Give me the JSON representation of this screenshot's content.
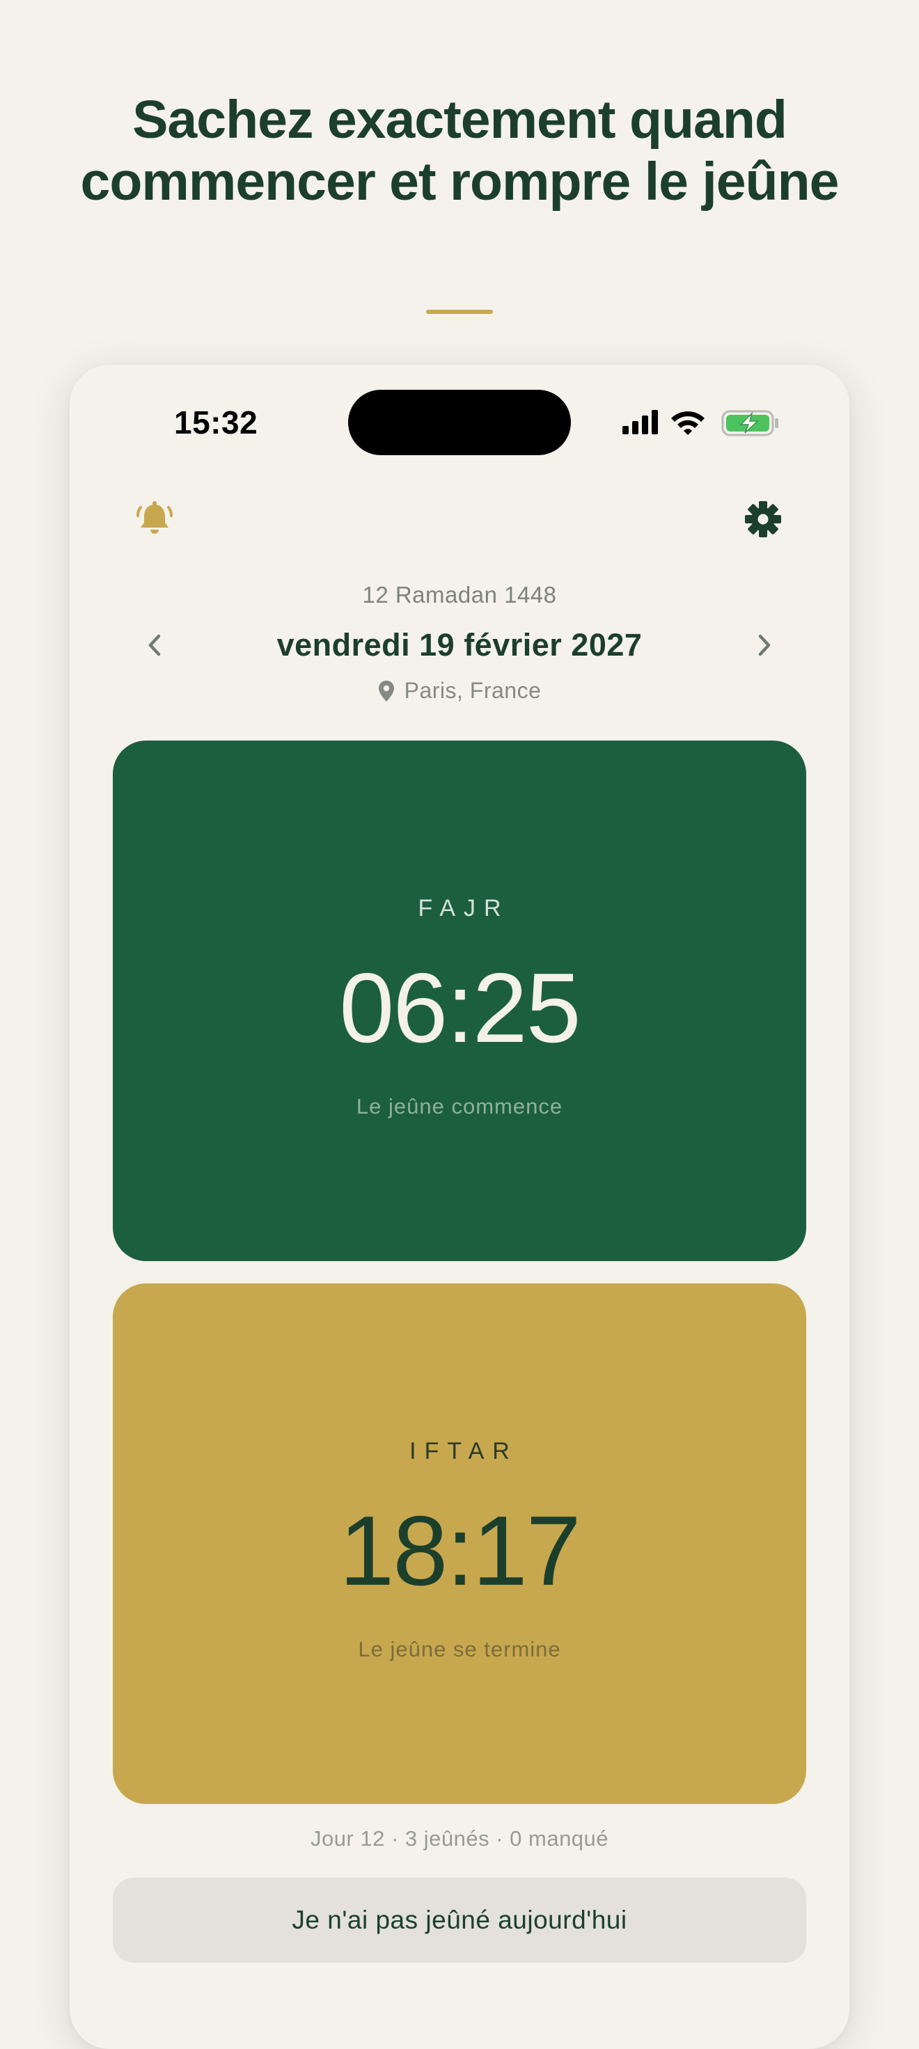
{
  "marketing": {
    "headline": "Sachez exactement quand commencer et rompre le jeûne"
  },
  "status_bar": {
    "time": "15:32",
    "icons": [
      "cellular-signal-icon",
      "wifi-icon",
      "battery-charging-icon"
    ]
  },
  "toolbar": {
    "left_icon": "bell-icon",
    "right_icon": "gear-icon"
  },
  "date_header": {
    "hijri_date": "12 Ramadan 1448",
    "gregorian_date": "vendredi 19 février 2027",
    "location": "Paris, France",
    "prev_icon": "chevron-left-icon",
    "next_icon": "chevron-right-icon",
    "location_icon": "map-pin-icon"
  },
  "fajr": {
    "label": "FAJR",
    "time": "06:25",
    "subtitle": "Le jeûne commence"
  },
  "iftar": {
    "label": "IFTAR",
    "time": "18:17",
    "subtitle": "Le jeûne se termine"
  },
  "stats": {
    "text": "Jour 12 · 3 jeûnés · 0 manqué"
  },
  "actions": {
    "missed_fast_label": "Je n'ai pas jeûné aujourd'hui"
  },
  "colors": {
    "background": "#f5f2eb",
    "primary_green": "#1c5f3e",
    "dark_green_text": "#1c3f2c",
    "gold": "#c7a84f",
    "button_gray": "#e3e1da"
  }
}
